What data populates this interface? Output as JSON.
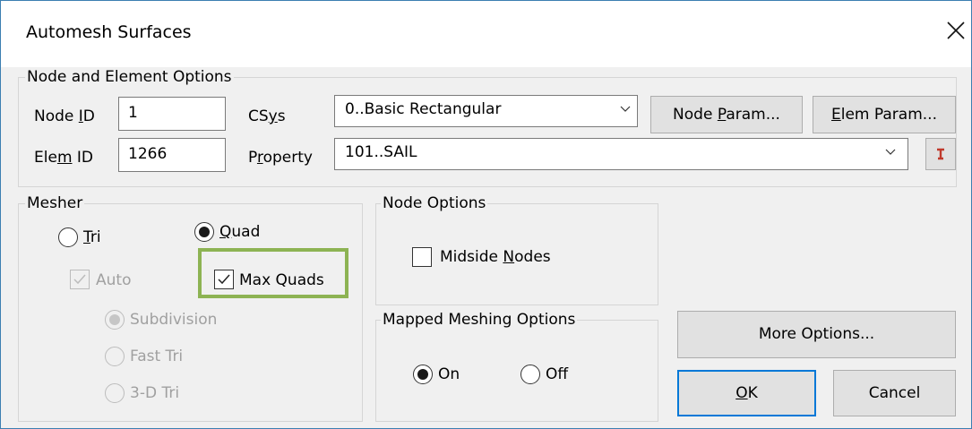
{
  "window": {
    "title": "Automesh Surfaces"
  },
  "node_element": {
    "group_label": "Node and Element Options",
    "node_id_label_pre": "Node ",
    "node_id_label_key": "I",
    "node_id_label_post": "D",
    "node_id_value": "1",
    "elem_id_label_pre": "Ele",
    "elem_id_label_key": "m",
    "elem_id_label_post": " ID",
    "elem_id_value": "1266",
    "csys_label_pre": "CS",
    "csys_label_key": "y",
    "csys_label_post": "s",
    "csys_value": "0..Basic Rectangular",
    "property_label_pre": "P",
    "property_label_key": "r",
    "property_label_post": "operty",
    "property_value": "101..SAIL",
    "node_param_pre": "Node ",
    "node_param_key": "P",
    "node_param_post": "aram...",
    "elem_param_pre": "",
    "elem_param_key": "E",
    "elem_param_post": "lem Param..."
  },
  "mesher": {
    "group_label": "Mesher",
    "tri_key": "T",
    "tri_post": "ri",
    "quad_key": "Q",
    "quad_post": "uad",
    "auto_label": "Auto",
    "max_quads_label": "Max Quads",
    "subdivision_label": "Subdivision",
    "fast_tri_label": "Fast Tri",
    "tri3d_label": "3-D Tri",
    "selected": "Quad",
    "auto_checked": true,
    "max_quads_checked": true
  },
  "node_options": {
    "group_label": "Node Options",
    "midside_pre": "Midside ",
    "midside_key": "N",
    "midside_post": "odes",
    "midside_checked": false
  },
  "mapped_meshing": {
    "group_label": "Mapped Meshing Options",
    "on_label": "On",
    "off_label": "Off",
    "selected": "On"
  },
  "buttons": {
    "more_options": "More Options...",
    "ok_key": "O",
    "ok_post": "K",
    "cancel": "Cancel"
  },
  "colors": {
    "highlight": "#8db353",
    "focus": "#0078d7",
    "pick_icon": "#c0392b"
  },
  "icons": {
    "close": "close-icon",
    "pick": "pick-icon",
    "dropdown": "chevron-down-icon",
    "check": "check-icon"
  }
}
